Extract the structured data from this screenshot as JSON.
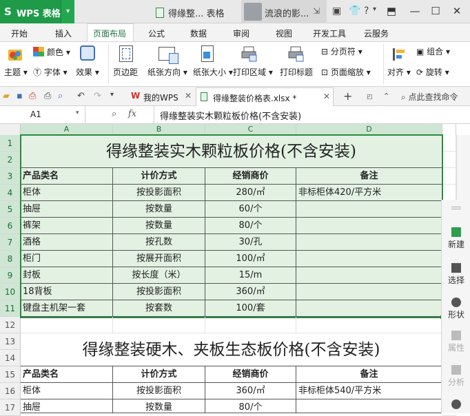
{
  "app": {
    "logo": "S",
    "name": "WPS 表格",
    "doc_title": "得缘整... 表格",
    "user_name": "流浪的影..."
  },
  "ribbon_tabs": [
    "开始",
    "插入",
    "页面布局",
    "公式",
    "数据",
    "审阅",
    "视图",
    "开发工具",
    "云服务"
  ],
  "active_tab": "页面布局",
  "ribbon": {
    "theme": "主题",
    "colors": "颜色",
    "fonts": "字体",
    "effects": "效果",
    "margins": "页边距",
    "orientation": "纸张方向",
    "size": "纸张大小",
    "print_area": "打印区域",
    "print_titles": "打印标题",
    "page_break": "分页符",
    "page_zoom": "页面缩放",
    "align": "对齐",
    "group": "组合",
    "rotate": "旋转"
  },
  "doc_tabs": [
    {
      "label": "我的WPS"
    },
    {
      "label": "得缘整装价格表.xlsx *"
    }
  ],
  "find_cmd": "点此查找命令",
  "formula_bar": {
    "name_box": "A1",
    "fx": "fx",
    "formula": "得缘整装实木颗粒板价格(不含安装)"
  },
  "columns": [
    "A",
    "B",
    "C",
    "D"
  ],
  "rows": [
    "1",
    "2",
    "3",
    "4",
    "5",
    "6",
    "7",
    "8",
    "9",
    "10",
    "11",
    "12",
    "13",
    "14",
    "15",
    "16",
    "17"
  ],
  "table1": {
    "title": "得缘整装实木颗粒板价格(不含安装)",
    "headers": [
      "产品类名",
      "计价方式",
      "经销商价",
      "备注"
    ],
    "rows": [
      [
        "柜体",
        "按投影面积",
        "280/㎡",
        "非标柜体420/平方米"
      ],
      [
        "抽屉",
        "按数量",
        "60/个",
        ""
      ],
      [
        "裤架",
        "按数量",
        "80/个",
        ""
      ],
      [
        "酒格",
        "按孔数",
        "30/孔",
        ""
      ],
      [
        "柜门",
        "按展开面积",
        "100/㎡",
        ""
      ],
      [
        "封板",
        "按长度（米）",
        "15/m",
        ""
      ],
      [
        "18背板",
        "按投影面积",
        "360/㎡",
        ""
      ],
      [
        "键盘主机架一套",
        "按套数",
        "100/套",
        ""
      ]
    ]
  },
  "table2": {
    "title": "得缘整装硬木、夹板生态板价格(不含安装)",
    "headers": [
      "产品类名",
      "计价方式",
      "经销商价",
      "备注"
    ],
    "rows": [
      [
        "柜体",
        "按投影面积",
        "360/㎡",
        "非标柜体540/平方米"
      ],
      [
        "抽屉",
        "按数量",
        "80/个",
        ""
      ]
    ]
  },
  "side_panel": [
    "新建",
    "选择",
    "形状",
    "属性",
    "分析"
  ],
  "colors": {
    "accent": "#1f9a48",
    "selection": "#e3f1e3"
  }
}
